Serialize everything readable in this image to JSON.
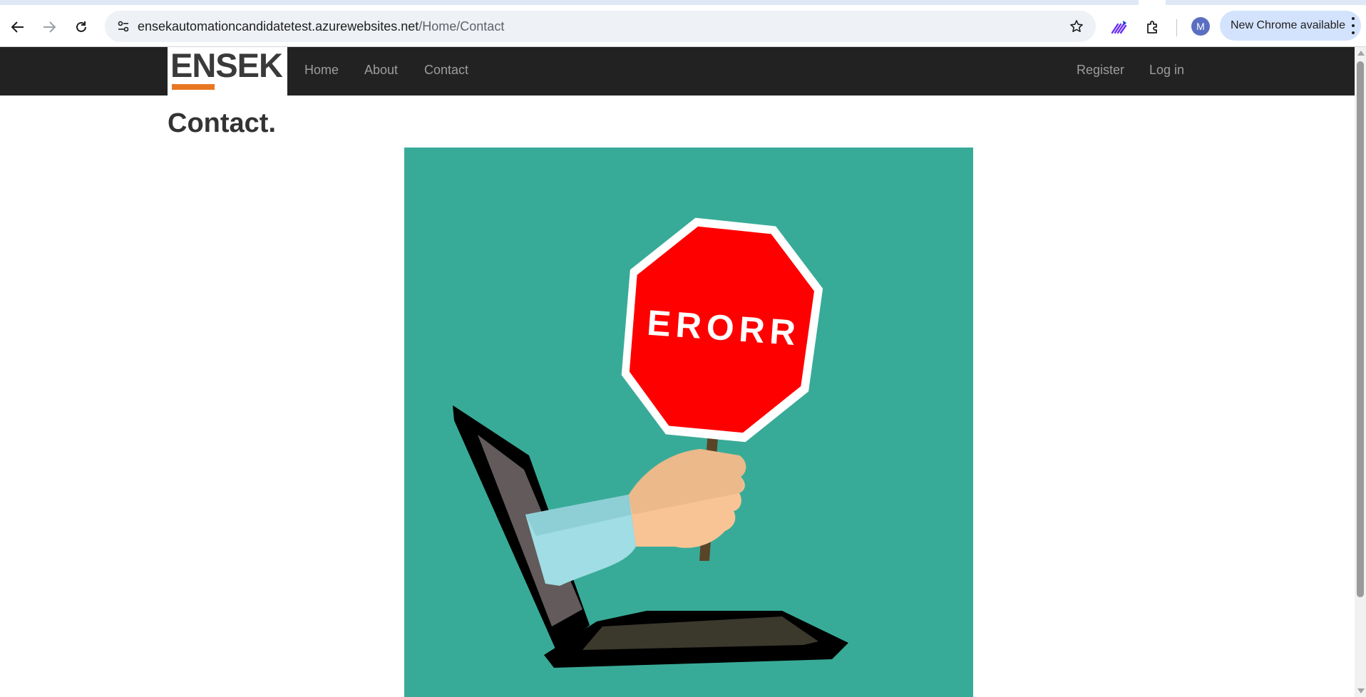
{
  "browser": {
    "url_host": "ensekautomationcandidatetest.azurewebsites.net",
    "url_path": "/Home/Contact",
    "profile_initial": "M",
    "update_label": "New Chrome available",
    "icons": [
      "back-arrow-icon",
      "forward-arrow-icon",
      "reload-icon",
      "site-info-icon",
      "star-icon",
      "extension-puzzle-icon",
      "menu-dots-icon"
    ]
  },
  "site": {
    "brand_name": "ENSEK",
    "brand_accent_color": "#e87722",
    "nav": [
      {
        "label": "Home"
      },
      {
        "label": "About"
      },
      {
        "label": "Contact"
      }
    ],
    "auth": [
      {
        "label": "Register"
      },
      {
        "label": "Log in"
      }
    ]
  },
  "page": {
    "title": "Contact.",
    "hero": {
      "sign_text": "ERORR",
      "background_color": "#38ab98",
      "sign_color": "#ff0000"
    }
  }
}
